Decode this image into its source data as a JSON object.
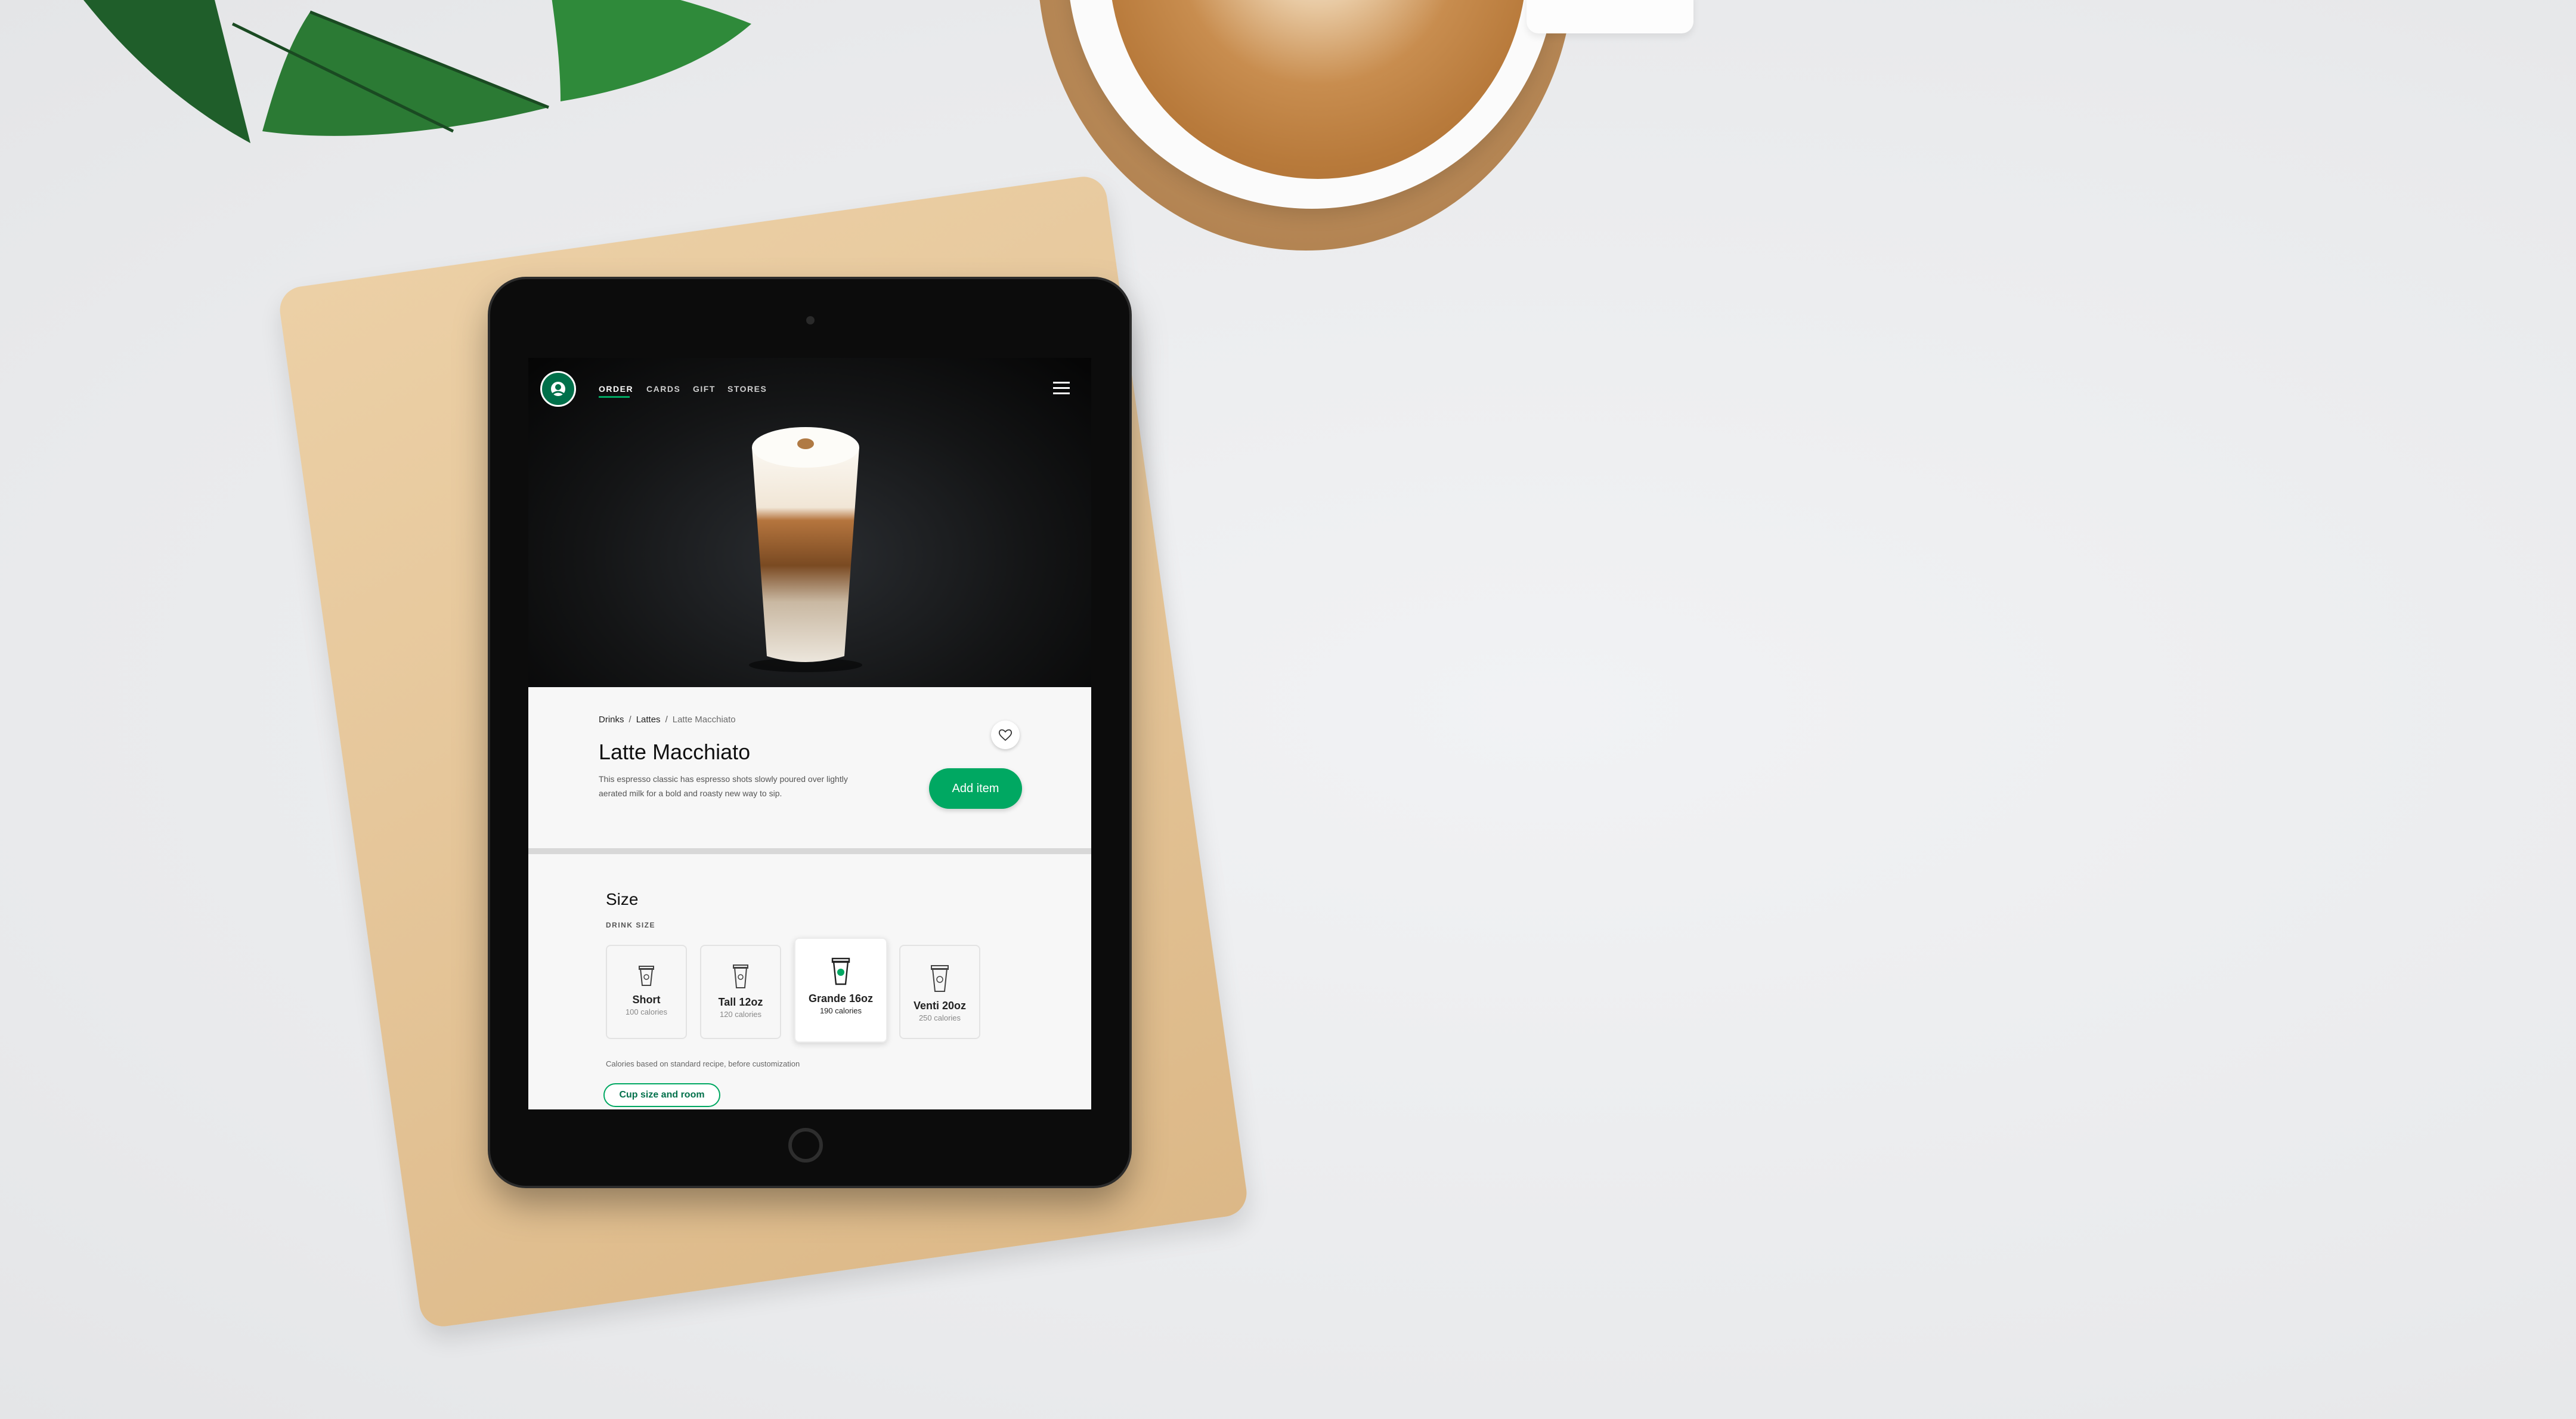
{
  "nav": {
    "items": [
      {
        "label": "ORDER",
        "active": true
      },
      {
        "label": "CARDS",
        "active": false
      },
      {
        "label": "GIFT",
        "active": false
      },
      {
        "label": "STORES",
        "active": false
      }
    ],
    "menu_icon": "hamburger-icon",
    "logo": "siren-logo"
  },
  "breadcrumb": [
    "Drinks",
    "Lattes",
    "Latte Macchiato"
  ],
  "product": {
    "title": "Latte Macchiato",
    "description": "This espresso classic has espresso shots slowly poured over lightly aerated milk for a bold and roasty new way to sip.",
    "add_label": "Add item",
    "favorite_icon": "heart-icon"
  },
  "size": {
    "title": "Size",
    "subtitle": "DRINK SIZE",
    "options": [
      {
        "name": "Short",
        "calories": "100 calories",
        "selected": false
      },
      {
        "name": "Tall 12oz",
        "calories": "120 calories",
        "selected": false
      },
      {
        "name": "Grande 16oz",
        "calories": "190 calories",
        "selected": true
      },
      {
        "name": "Venti 20oz",
        "calories": "250 calories",
        "selected": false
      }
    ],
    "note": "Calories based on standard recipe, before customization",
    "cup_button": "Cup size and room"
  },
  "colors": {
    "accent": "#00a862",
    "brand": "#00704a"
  }
}
